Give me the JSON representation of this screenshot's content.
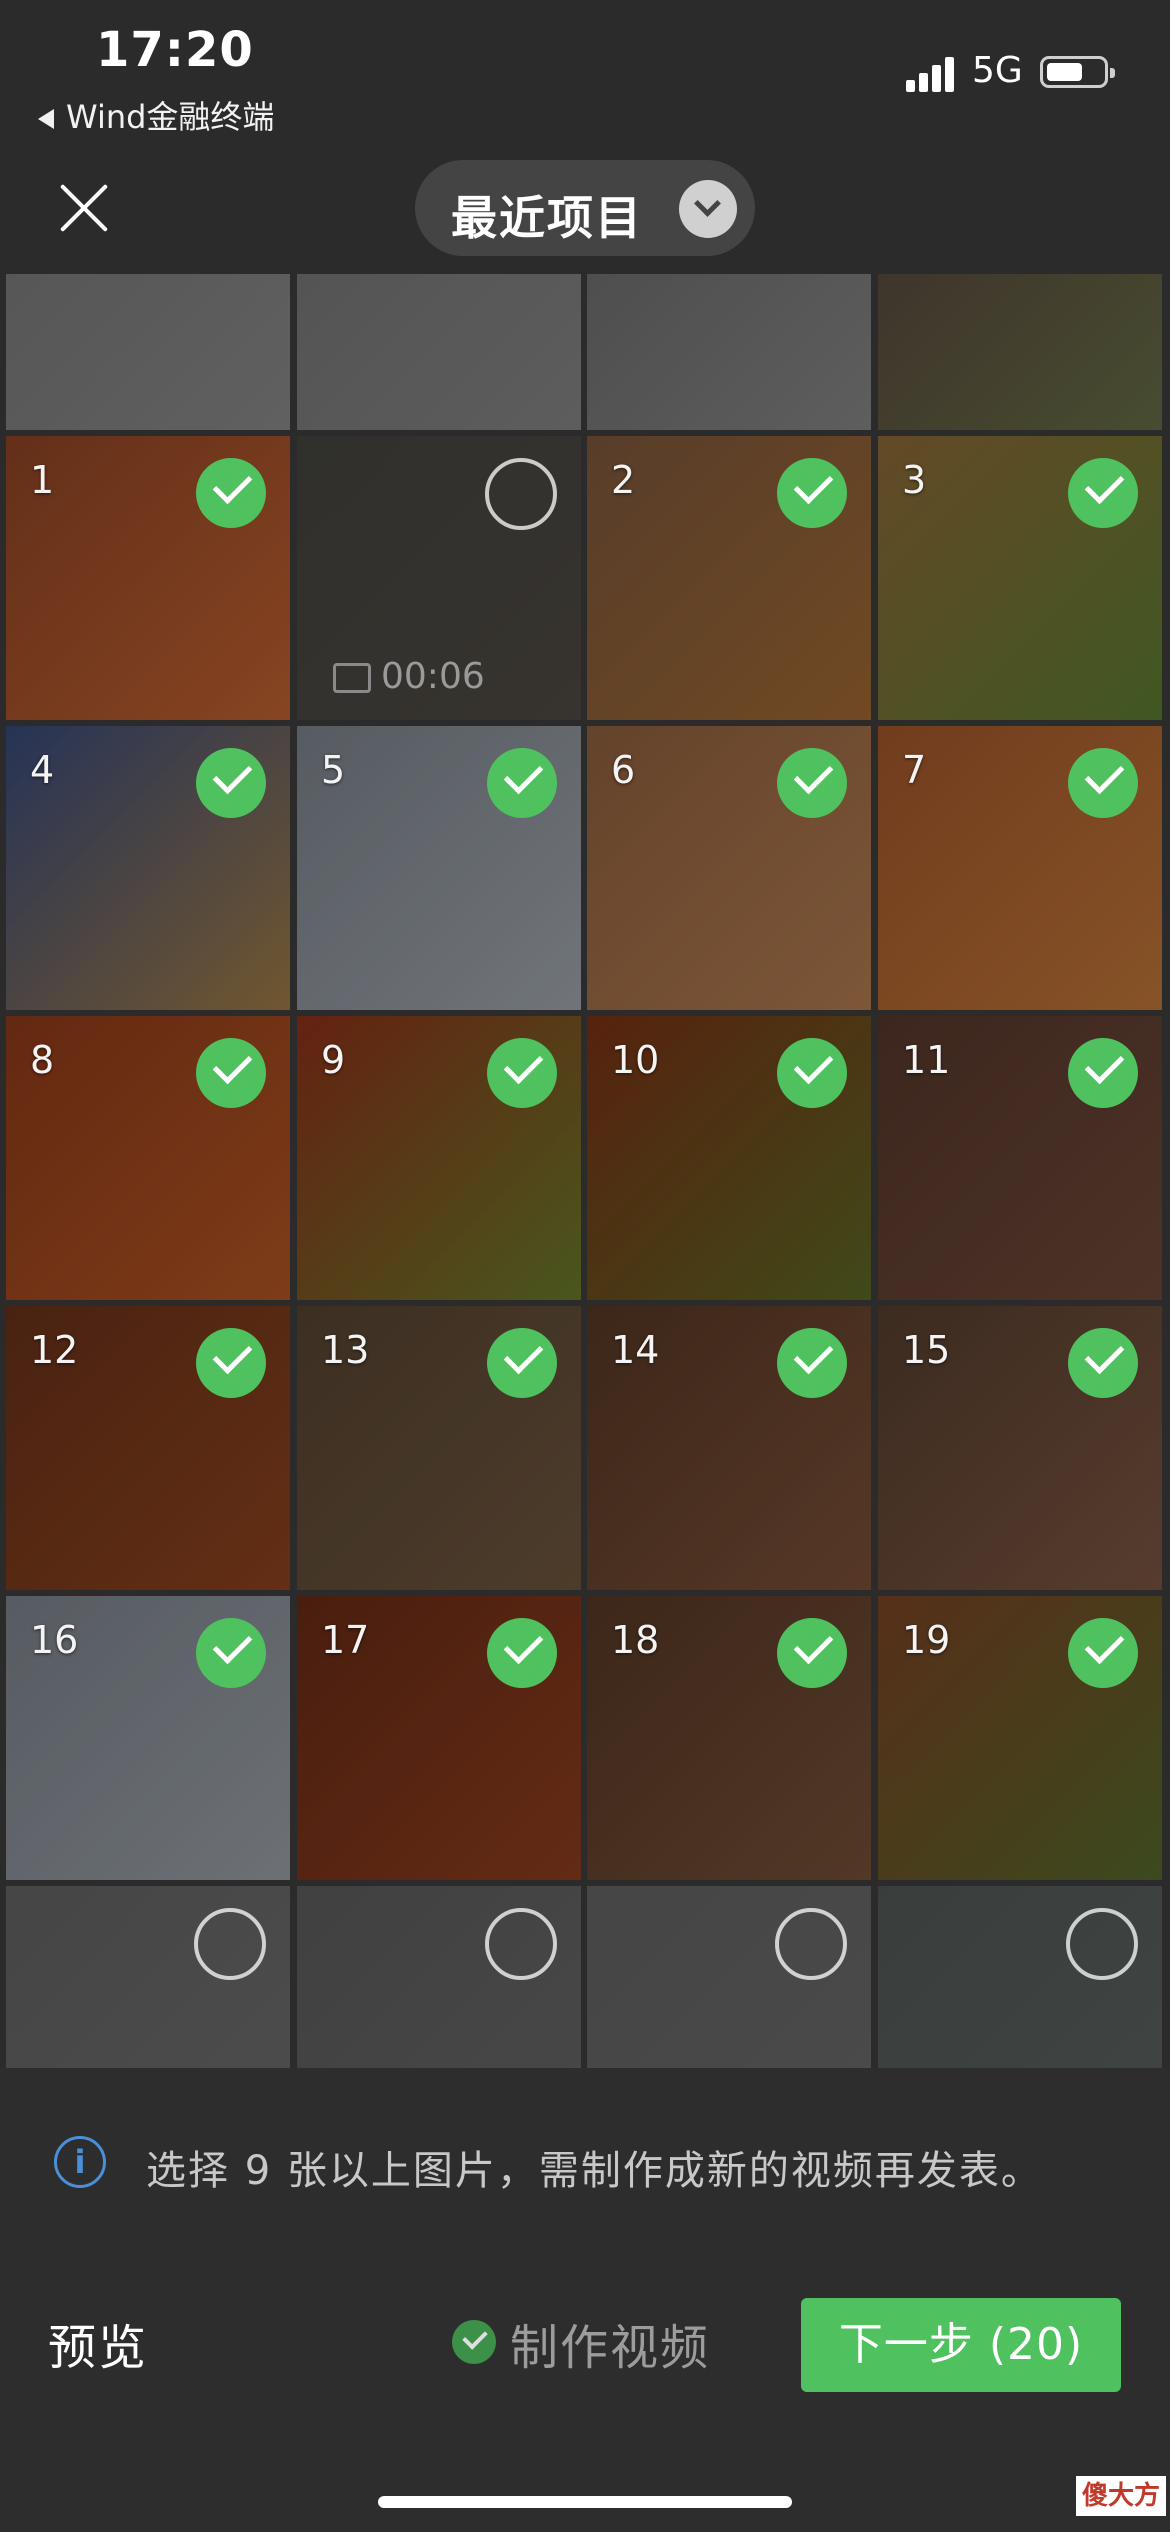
{
  "status_bar": {
    "time": "17:20",
    "back_app": "Wind金融终端",
    "network": "5G",
    "battery_level": 0.65
  },
  "header": {
    "album_title": "最近项目"
  },
  "grid": {
    "top_partial": [
      {
        "colors": [
          "#8f8f8f",
          "#a5a5a5"
        ]
      },
      {
        "colors": [
          "#8a8a8a",
          "#9e9e9e"
        ]
      },
      {
        "colors": [
          "#7d7d7d",
          "#a0a0a0"
        ]
      },
      {
        "colors": [
          "#5b4530",
          "#6f7a3c"
        ]
      }
    ],
    "rows": [
      [
        {
          "num": "1",
          "selected": true,
          "colors": [
            "#7a3a1f",
            "#a5542a"
          ]
        },
        {
          "num": "",
          "selected": false,
          "video_time": "00:06",
          "colors": [
            "#3a3a33",
            "#4a4236"
          ]
        },
        {
          "num": "2",
          "selected": true,
          "colors": [
            "#6b4b33",
            "#8a5a2c"
          ]
        },
        {
          "num": "3",
          "selected": true,
          "colors": [
            "#7a5a30",
            "#4f6b2a"
          ]
        }
      ],
      [
        {
          "num": "4",
          "selected": true,
          "colors": [
            "#2f3f6a",
            "#8a6a3a"
          ]
        },
        {
          "num": "5",
          "selected": true,
          "colors": [
            "#6a7078",
            "#8a8f95"
          ]
        },
        {
          "num": "6",
          "selected": true,
          "colors": [
            "#7a5235",
            "#9a6a45"
          ]
        },
        {
          "num": "7",
          "selected": true,
          "colors": [
            "#8a4a24",
            "#a56530"
          ]
        }
      ],
      [
        {
          "num": "8",
          "selected": true,
          "colors": [
            "#7a3215",
            "#9a4a1f"
          ]
        },
        {
          "num": "9",
          "selected": true,
          "colors": [
            "#7a2a15",
            "#5a6a25"
          ]
        },
        {
          "num": "10",
          "selected": true,
          "colors": [
            "#6a2a12",
            "#4f5a1f"
          ]
        },
        {
          "num": "11",
          "selected": true,
          "colors": [
            "#4a2f25",
            "#5f3f30"
          ]
        }
      ],
      [
        {
          "num": "12",
          "selected": true,
          "colors": [
            "#5a2a15",
            "#7a3a1a"
          ]
        },
        {
          "num": "13",
          "selected": true,
          "colors": [
            "#4a3a2a",
            "#5f4a35"
          ]
        },
        {
          "num": "14",
          "selected": true,
          "colors": [
            "#4a301f",
            "#6a4530"
          ]
        },
        {
          "num": "15",
          "selected": true,
          "colors": [
            "#4a3528",
            "#6a4a38"
          ]
        }
      ],
      [
        {
          "num": "16",
          "selected": true,
          "colors": [
            "#6a7078",
            "#858a90"
          ]
        },
        {
          "num": "17",
          "selected": true,
          "colors": [
            "#5a2512",
            "#7a351a"
          ]
        },
        {
          "num": "18",
          "selected": true,
          "colors": [
            "#4a3020",
            "#65452f"
          ]
        },
        {
          "num": "19",
          "selected": true,
          "colors": [
            "#6a3a1f",
            "#4a5a25"
          ]
        }
      ],
      [
        {
          "num": "",
          "selected": false,
          "colors": [
            "#6a6a6a",
            "#7a7a7a"
          ]
        },
        {
          "num": "",
          "selected": false,
          "colors": [
            "#5f5f5f",
            "#707070"
          ]
        },
        {
          "num": "",
          "selected": false,
          "colors": [
            "#6a6a6a",
            "#757575"
          ]
        },
        {
          "num": "",
          "selected": false,
          "colors": [
            "#4f5a57",
            "#5f6a66"
          ]
        }
      ]
    ]
  },
  "bottom": {
    "info_text": "选择 9 张以上图片，需制作成新的视频再发表。",
    "preview_label": "预览",
    "make_video_label": "制作视频",
    "next_label": "下一步 (20)",
    "watermark": "傻大方",
    "accent_color": "#4fc15e",
    "info_color": "#4a90d9"
  }
}
